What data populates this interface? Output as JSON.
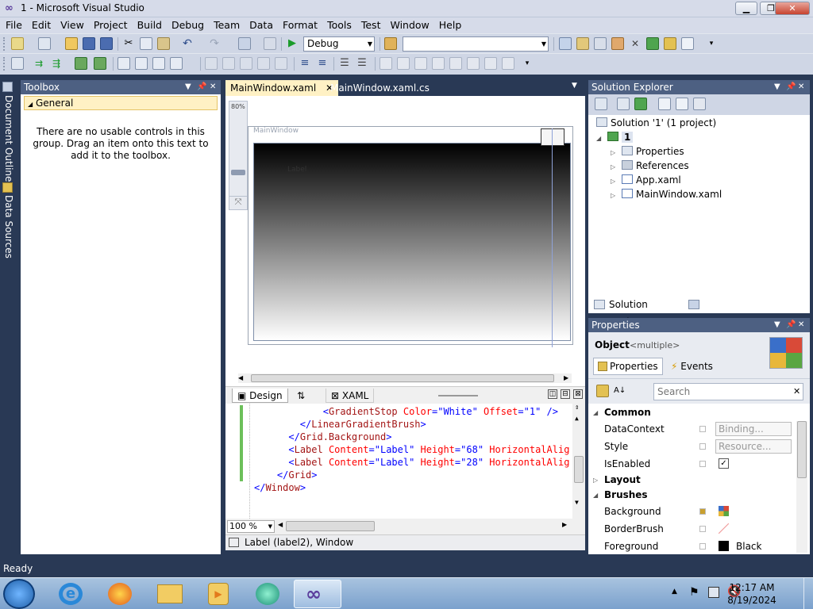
{
  "window": {
    "title": "1 - Microsoft Visual Studio"
  },
  "menu": [
    "File",
    "Edit",
    "View",
    "Project",
    "Build",
    "Debug",
    "Team",
    "Data",
    "Format",
    "Tools",
    "Test",
    "Window",
    "Help"
  ],
  "toolbar": {
    "config_combo": "Debug",
    "search_combo": ""
  },
  "side_tabs": [
    "Document Outline",
    "Data Sources"
  ],
  "toolbox": {
    "title": "Toolbox",
    "group": "General",
    "message": "There are no usable controls in this group. Drag an item onto this text to add it to the toolbox."
  },
  "editor": {
    "tabs": [
      "MainWindow.xaml",
      "MainWindow.xaml.cs"
    ],
    "zoom_label": "80%",
    "window_caption": "MainWindow",
    "label_text": "Label",
    "split_tabs": {
      "design": "Design",
      "swap": "⇅",
      "xaml": "XAML"
    },
    "xaml_lines": [
      {
        "indent": "            ",
        "parts": [
          [
            "br",
            "<"
          ],
          [
            "tag",
            "GradientStop"
          ],
          [
            "attr",
            " Color"
          ],
          [
            "br",
            "="
          ],
          [
            "val",
            "\"White\""
          ],
          [
            "attr",
            " Offset"
          ],
          [
            "br",
            "="
          ],
          [
            "val",
            "\"1\""
          ],
          [
            "br",
            " />"
          ]
        ]
      },
      {
        "indent": "        ",
        "parts": [
          [
            "br",
            "</"
          ],
          [
            "tag",
            "LinearGradientBrush"
          ],
          [
            "br",
            ">"
          ]
        ]
      },
      {
        "indent": "      ",
        "parts": [
          [
            "br",
            "</"
          ],
          [
            "tag",
            "Grid.Background"
          ],
          [
            "br",
            ">"
          ]
        ]
      },
      {
        "indent": "      ",
        "parts": [
          [
            "br",
            "<"
          ],
          [
            "tag",
            "Label"
          ],
          [
            "attr",
            " Content"
          ],
          [
            "br",
            "="
          ],
          [
            "val",
            "\"Label\""
          ],
          [
            "attr",
            " Height"
          ],
          [
            "br",
            "="
          ],
          [
            "val",
            "\"68\""
          ],
          [
            "attr",
            " HorizontalAlig"
          ]
        ]
      },
      {
        "indent": "      ",
        "parts": [
          [
            "br",
            "<"
          ],
          [
            "tag",
            "Label"
          ],
          [
            "attr",
            " Content"
          ],
          [
            "br",
            "="
          ],
          [
            "val",
            "\"Label\""
          ],
          [
            "attr",
            " Height"
          ],
          [
            "br",
            "="
          ],
          [
            "val",
            "\"28\""
          ],
          [
            "attr",
            " HorizontalAlig"
          ]
        ]
      },
      {
        "indent": "    ",
        "parts": [
          [
            "br",
            "</"
          ],
          [
            "tag",
            "Grid"
          ],
          [
            "br",
            ">"
          ]
        ]
      },
      {
        "indent": "",
        "parts": [
          [
            "br",
            "</"
          ],
          [
            "tag",
            "Window"
          ],
          [
            "br",
            ">"
          ]
        ]
      }
    ],
    "code_zoom": "100 %",
    "status": "Label (label2), Window"
  },
  "solution_explorer": {
    "title": "Solution Explorer",
    "solution": "Solution '1' (1 project)",
    "project": "1",
    "items": [
      "Properties",
      "References",
      "App.xaml",
      "MainWindow.xaml"
    ],
    "bottom_tabs": [
      "Solution Explorer",
      "Team Explorer"
    ]
  },
  "properties": {
    "title": "Properties",
    "object_label": "Object",
    "object_value": "<multiple>",
    "tabs": [
      "Properties",
      "Events"
    ],
    "search_placeholder": "Search",
    "rows": [
      {
        "type": "cat",
        "name": "Common"
      },
      {
        "type": "prop",
        "name": "DataContext",
        "value": "Binding..."
      },
      {
        "type": "prop",
        "name": "Style",
        "value": "Resource..."
      },
      {
        "type": "prop",
        "name": "IsEnabled",
        "value": "✓"
      },
      {
        "type": "cat",
        "name": "Layout"
      },
      {
        "type": "cat",
        "name": "Brushes"
      },
      {
        "type": "prop",
        "name": "Background",
        "value": ""
      },
      {
        "type": "prop",
        "name": "BorderBrush",
        "value": ""
      },
      {
        "type": "prop",
        "name": "Foreground",
        "value": "Black"
      }
    ]
  },
  "status_bar": {
    "text": "Ready"
  },
  "taskbar": {
    "time": "12:17 AM",
    "date": "8/19/2024"
  }
}
